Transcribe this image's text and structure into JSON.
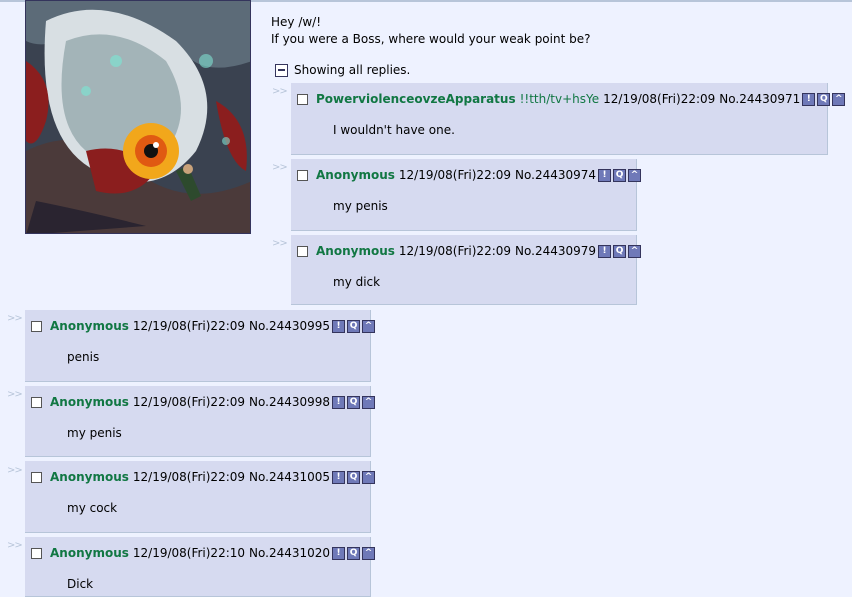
{
  "op": {
    "line1": "Hey /w/!",
    "line2": "If you were a Boss, where would your weak point be?",
    "show_all": "Showing all replies."
  },
  "arrows": ">>",
  "buttons": {
    "report": "!",
    "quote": "Q",
    "expand": "^"
  },
  "colors": {
    "background": "#eef2ff",
    "reply_bg": "#d6daf0",
    "name": "#117743",
    "border": "#b7c5d9"
  },
  "replies": [
    {
      "name": "PowerviolenceovzeApparatus",
      "trip": "!!tth/tv+hsYe",
      "date": "12/19/08(Fri)22:09",
      "number": "No.24430971",
      "message": "I wouldn't have one."
    },
    {
      "name": "Anonymous",
      "date": "12/19/08(Fri)22:09",
      "number": "No.24430974",
      "message": "my penis"
    },
    {
      "name": "Anonymous",
      "date": "12/19/08(Fri)22:09",
      "number": "No.24430979",
      "message": "my dick"
    },
    {
      "name": "Anonymous",
      "date": "12/19/08(Fri)22:09",
      "number": "No.24430995",
      "message": "penis"
    },
    {
      "name": "Anonymous",
      "date": "12/19/08(Fri)22:09",
      "number": "No.24430998",
      "message": "my penis"
    },
    {
      "name": "Anonymous",
      "date": "12/19/08(Fri)22:09",
      "number": "No.24431005",
      "message": "my cock"
    },
    {
      "name": "Anonymous",
      "date": "12/19/08(Fri)22:10",
      "number": "No.24431020",
      "message": "Dick"
    }
  ]
}
